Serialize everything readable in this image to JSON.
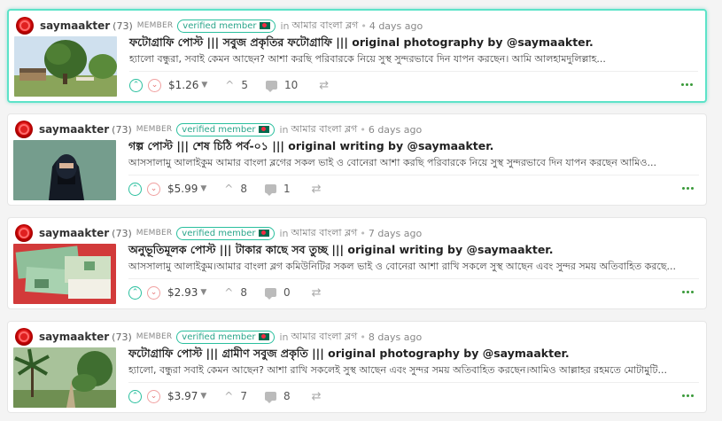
{
  "posts": [
    {
      "author": "saymaakter",
      "reputation": "(73)",
      "role": "MEMBER",
      "badge": "verified member",
      "in_label": "in",
      "community": "আমার বাংলা ব্লগ",
      "time": "4 days ago",
      "title": "ফটোগ্রাফি পোস্ট ||| সবুজ প্রকৃতির ফটোগ্রাফি ||| original photography by @saymaakter.",
      "snippet": "হ্যালো বন্ধুরা, সবাই কেমন আছেন? আশা করছি পরিবারকে নিয়ে সুস্থ সুন্দরভাবে দিন যাপন করছেন। আমি আলহামদুলিল্লাহ...",
      "payout": "$1.26",
      "votes": "5",
      "comments": "10",
      "thumb": "tree"
    },
    {
      "author": "saymaakter",
      "reputation": "(73)",
      "role": "MEMBER",
      "badge": "verified member",
      "in_label": "in",
      "community": "আমার বাংলা ব্লগ",
      "time": "6 days ago",
      "title": "গল্প পোস্ট ||| শেষ চিঠি পর্ব-০১ ||| original writing by @saymaakter.",
      "snippet": "আসসালামু আলাইকুম আমার বাংলা ব্লগের সকল ভাই ও বোনেরা আশা করছি পরিবারকে নিয়ে সুস্থ সুন্দরভাবে দিন যাপন করছেন আমিও...",
      "payout": "$5.99",
      "votes": "8",
      "comments": "1",
      "thumb": "woman"
    },
    {
      "author": "saymaakter",
      "reputation": "(73)",
      "role": "MEMBER",
      "badge": "verified member",
      "in_label": "in",
      "community": "আমার বাংলা ব্লগ",
      "time": "7 days ago",
      "title": "অনুভূতিমূলক পোস্ট ||| টাকার কাছে সব তুচ্ছ ||| original writing by @saymaakter.",
      "snippet": "আসসালামু আলাইকুম।আমার বাংলা ব্লগ কমিউনিটির সকল ভাই ও বোনেরা আশা রাখি সকলে সুস্থ আছেন এবং সুন্দর সময় অতিবাহিত করছে...",
      "payout": "$2.93",
      "votes": "8",
      "comments": "0",
      "thumb": "money"
    },
    {
      "author": "saymaakter",
      "reputation": "(73)",
      "role": "MEMBER",
      "badge": "verified member",
      "in_label": "in",
      "community": "আমার বাংলা ব্লগ",
      "time": "8 days ago",
      "title": "ফটোগ্রাফি পোস্ট ||| গ্রামীণ সবুজ প্রকৃতি ||| original photography by @saymaakter.",
      "snippet": "হ্যালো, বন্ধুরা সবাই কেমন আছেন? আশা রাখি সকলেই সুস্থ আছেন এবং সুন্দর সময় অতিবাহিত করছেন।আমিও আল্লাহর রহমতে মোটামুটি...",
      "payout": "$3.97",
      "votes": "7",
      "comments": "8",
      "thumb": "palm"
    }
  ]
}
